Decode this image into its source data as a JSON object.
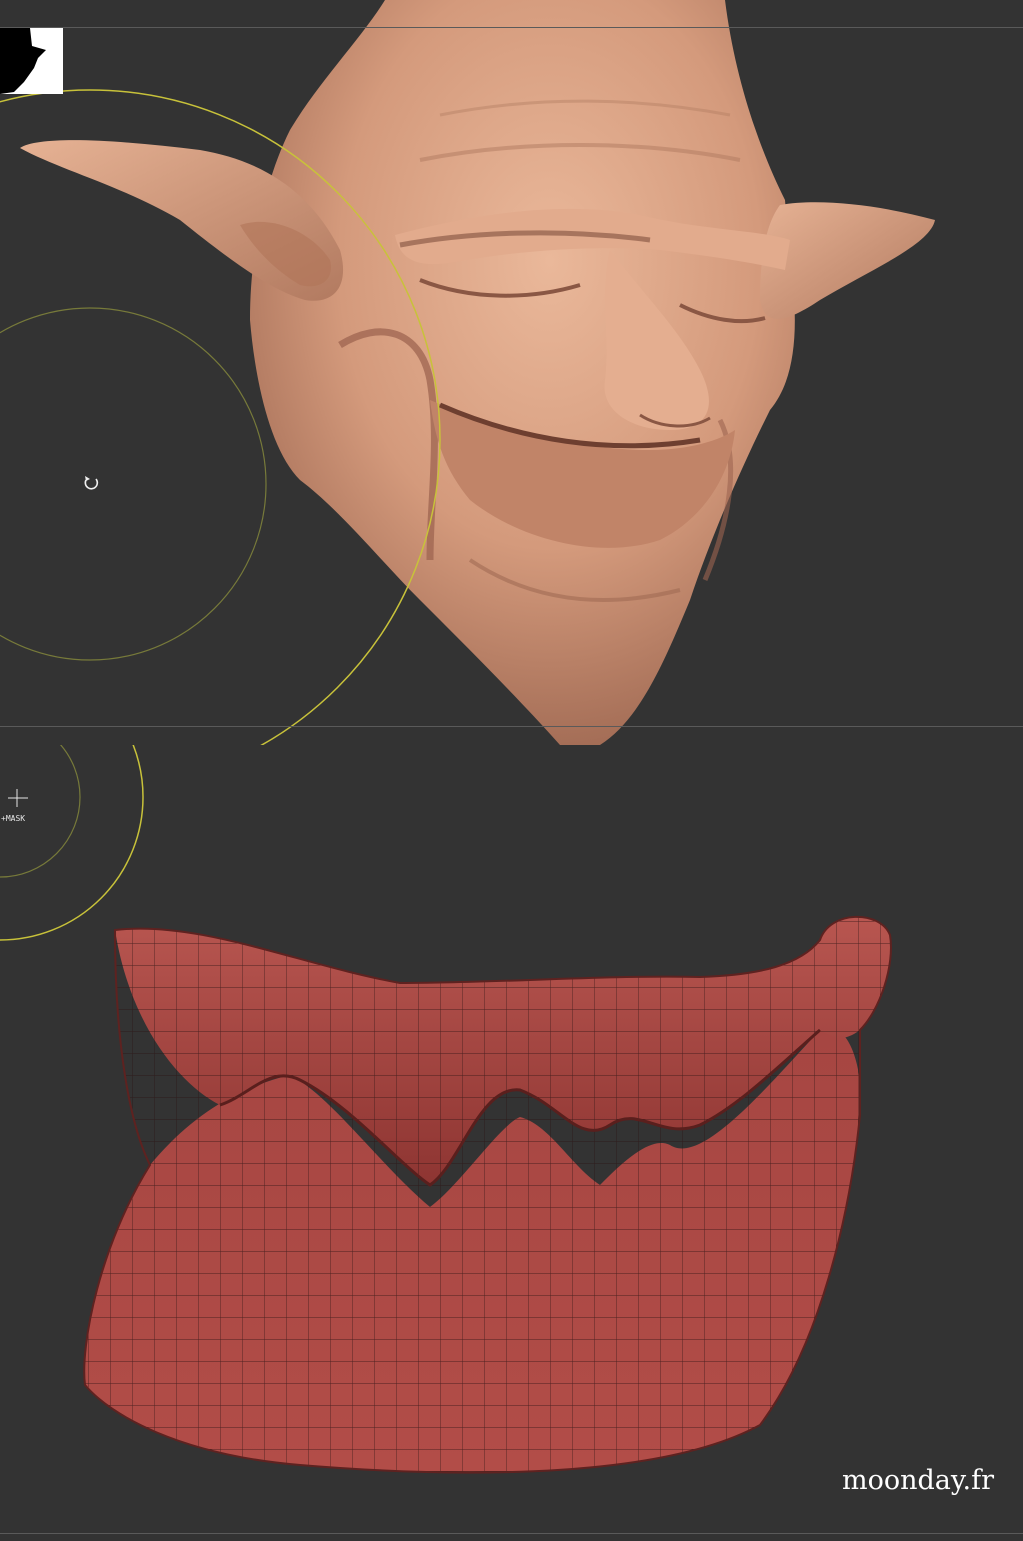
{
  "viewport_top": {
    "name": "goblin head sculpt view",
    "colors": {
      "background": "#333333",
      "skin": "#d49a7c",
      "brush_ring": "#c8c23a"
    }
  },
  "viewport_bottom": {
    "name": "lips mesh view",
    "colors": {
      "background": "#333333",
      "mesh": "#a84844",
      "wire": "#2b1212"
    },
    "cursor": {
      "icon": "crosshair-icon",
      "label": "+MASK"
    }
  },
  "watermark": "moonday.fr"
}
